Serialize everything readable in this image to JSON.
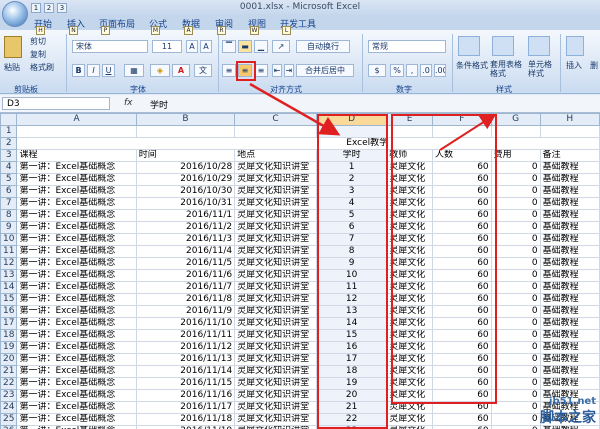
{
  "window": {
    "title": "0001.xlsx - Microsoft Excel",
    "qa": [
      "1",
      "2",
      "3"
    ]
  },
  "tabs": [
    {
      "label": "开始",
      "key": "H"
    },
    {
      "label": "插入",
      "key": "N"
    },
    {
      "label": "页面布局",
      "key": "P"
    },
    {
      "label": "公式",
      "key": "M"
    },
    {
      "label": "数据",
      "key": "A"
    },
    {
      "label": "审阅",
      "key": "R"
    },
    {
      "label": "视图",
      "key": "W"
    },
    {
      "label": "开发工具",
      "key": "L"
    }
  ],
  "ribbon": {
    "paste": "粘贴",
    "cut": "剪切",
    "copy": "复制",
    "format_painter": "格式刷",
    "clipboard": "剪贴板",
    "font_name": "宋体",
    "font_size": "11",
    "bold": "B",
    "italic": "I",
    "underline": "U",
    "font_group": "字体",
    "wrap": "自动换行",
    "merge": "合并后居中",
    "align_group": "对齐方式",
    "number_format": "常规",
    "percent": "%",
    "comma": ",",
    "number_group": "数字",
    "cond_format": "条件格式",
    "table_format": "套用表格格式",
    "cell_style": "单元格样式",
    "styles_group": "样式",
    "insert": "插入",
    "delete": "删"
  },
  "formula_bar": {
    "name_box": "D3",
    "fx": "fx",
    "value": "学时"
  },
  "sheet": {
    "columns": [
      "A",
      "B",
      "C",
      "D",
      "E",
      "F",
      "G",
      "H"
    ],
    "title": "Excel教学",
    "headers": [
      "课程",
      "时间",
      "地点",
      "学时",
      "教师",
      "人数",
      "费用",
      "备注"
    ],
    "rows": [
      [
        "第一讲：Excel基础概念",
        "2016/10/28",
        "灵犀文化知识讲堂",
        "1",
        "灵犀文化",
        "60",
        "0",
        "基础教程"
      ],
      [
        "第一讲：Excel基础概念",
        "2016/10/29",
        "灵犀文化知识讲堂",
        "2",
        "灵犀文化",
        "60",
        "0",
        "基础教程"
      ],
      [
        "第一讲：Excel基础概念",
        "2016/10/30",
        "灵犀文化知识讲堂",
        "3",
        "灵犀文化",
        "60",
        "0",
        "基础教程"
      ],
      [
        "第一讲：Excel基础概念",
        "2016/10/31",
        "灵犀文化知识讲堂",
        "4",
        "灵犀文化",
        "60",
        "0",
        "基础教程"
      ],
      [
        "第一讲：Excel基础概念",
        "2016/11/1",
        "灵犀文化知识讲堂",
        "5",
        "灵犀文化",
        "60",
        "0",
        "基础教程"
      ],
      [
        "第一讲：Excel基础概念",
        "2016/11/2",
        "灵犀文化知识讲堂",
        "6",
        "灵犀文化",
        "60",
        "0",
        "基础教程"
      ],
      [
        "第一讲：Excel基础概念",
        "2016/11/3",
        "灵犀文化知识讲堂",
        "7",
        "灵犀文化",
        "60",
        "0",
        "基础教程"
      ],
      [
        "第一讲：Excel基础概念",
        "2016/11/4",
        "灵犀文化知识讲堂",
        "8",
        "灵犀文化",
        "60",
        "0",
        "基础教程"
      ],
      [
        "第一讲：Excel基础概念",
        "2016/11/5",
        "灵犀文化知识讲堂",
        "9",
        "灵犀文化",
        "60",
        "0",
        "基础教程"
      ],
      [
        "第一讲：Excel基础概念",
        "2016/11/6",
        "灵犀文化知识讲堂",
        "10",
        "灵犀文化",
        "60",
        "0",
        "基础教程"
      ],
      [
        "第一讲：Excel基础概念",
        "2016/11/7",
        "灵犀文化知识讲堂",
        "11",
        "灵犀文化",
        "60",
        "0",
        "基础教程"
      ],
      [
        "第一讲：Excel基础概念",
        "2016/11/8",
        "灵犀文化知识讲堂",
        "12",
        "灵犀文化",
        "60",
        "0",
        "基础教程"
      ],
      [
        "第一讲：Excel基础概念",
        "2016/11/9",
        "灵犀文化知识讲堂",
        "13",
        "灵犀文化",
        "60",
        "0",
        "基础教程"
      ],
      [
        "第一讲：Excel基础概念",
        "2016/11/10",
        "灵犀文化知识讲堂",
        "14",
        "灵犀文化",
        "60",
        "0",
        "基础教程"
      ],
      [
        "第一讲：Excel基础概念",
        "2016/11/11",
        "灵犀文化知识讲堂",
        "15",
        "灵犀文化",
        "60",
        "0",
        "基础教程"
      ],
      [
        "第一讲：Excel基础概念",
        "2016/11/12",
        "灵犀文化知识讲堂",
        "16",
        "灵犀文化",
        "60",
        "0",
        "基础教程"
      ],
      [
        "第一讲：Excel基础概念",
        "2016/11/13",
        "灵犀文化知识讲堂",
        "17",
        "灵犀文化",
        "60",
        "0",
        "基础教程"
      ],
      [
        "第一讲：Excel基础概念",
        "2016/11/14",
        "灵犀文化知识讲堂",
        "18",
        "灵犀文化",
        "60",
        "0",
        "基础教程"
      ],
      [
        "第一讲：Excel基础概念",
        "2016/11/15",
        "灵犀文化知识讲堂",
        "19",
        "灵犀文化",
        "60",
        "0",
        "基础教程"
      ],
      [
        "第一讲：Excel基础概念",
        "2016/11/16",
        "灵犀文化知识讲堂",
        "20",
        "灵犀文化",
        "60",
        "0",
        "基础教程"
      ],
      [
        "第一讲：Excel基础概念",
        "2016/11/17",
        "灵犀文化知识讲堂",
        "21",
        "灵犀文化",
        "60",
        "0",
        "基础教程"
      ],
      [
        "第一讲：Excel基础概念",
        "2016/11/18",
        "灵犀文化知识讲堂",
        "22",
        "灵犀文化",
        "60",
        "0",
        "基础教程"
      ],
      [
        "第一讲：Excel基础概念",
        "2016/11/19",
        "灵犀文化知识讲堂",
        "23",
        "灵犀文化",
        "60",
        "0",
        "基础教程"
      ]
    ]
  },
  "watermark": {
    "line1": "jb51.net",
    "line2": "脚本之家"
  },
  "colors": {
    "highlight": "#e02020",
    "ribbon": "#dfe8f5"
  }
}
